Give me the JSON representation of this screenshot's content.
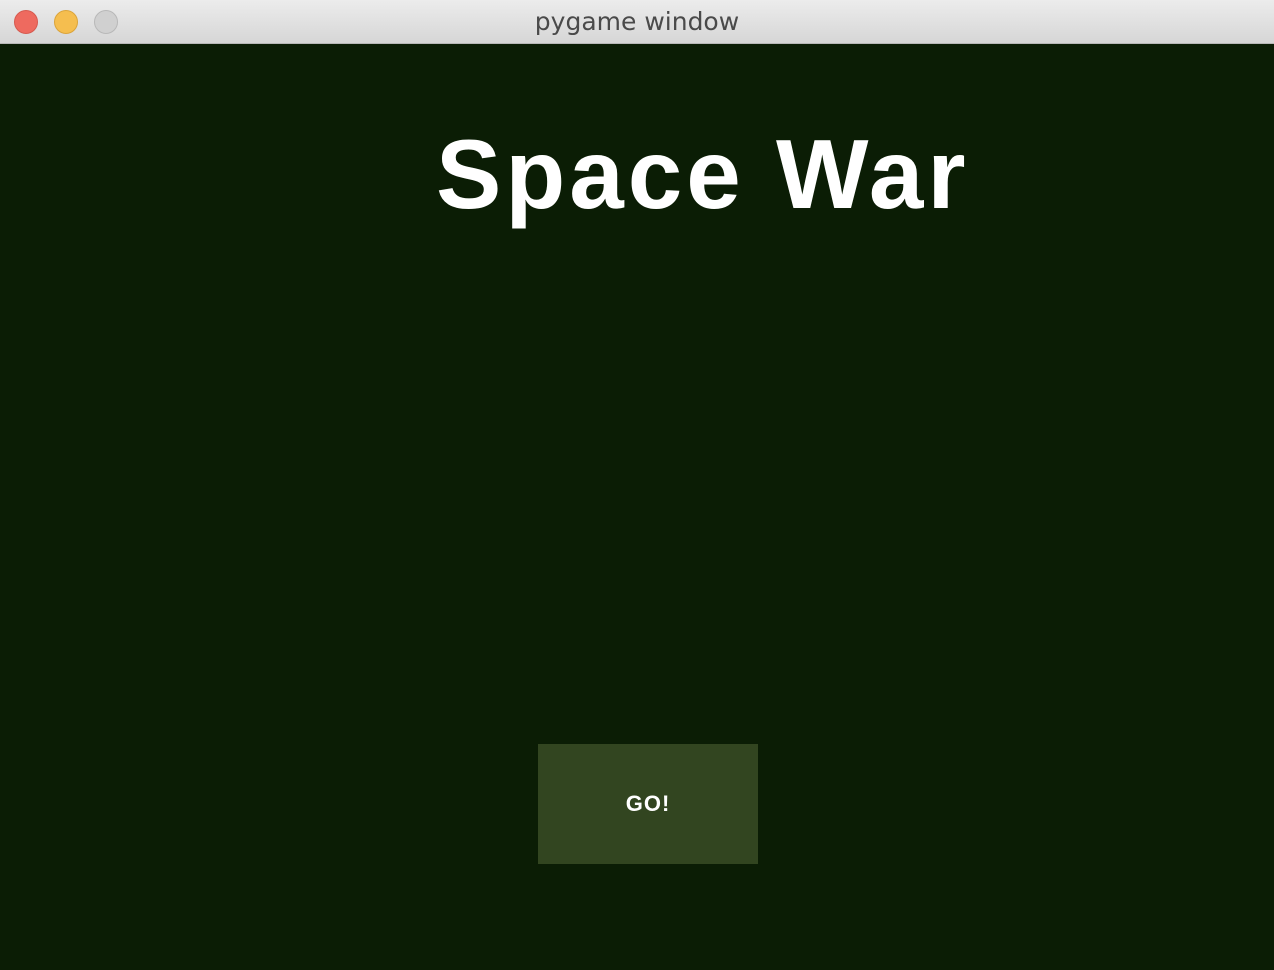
{
  "window": {
    "title": "pygame window",
    "controls": {
      "close": "close-button",
      "minimize": "minimize-button",
      "zoom": "zoom-button"
    }
  },
  "game": {
    "title": "Space War",
    "start_button_label": "GO!"
  },
  "colors": {
    "background": "#0b1d05",
    "button": "#324520",
    "text": "#ffffff"
  }
}
